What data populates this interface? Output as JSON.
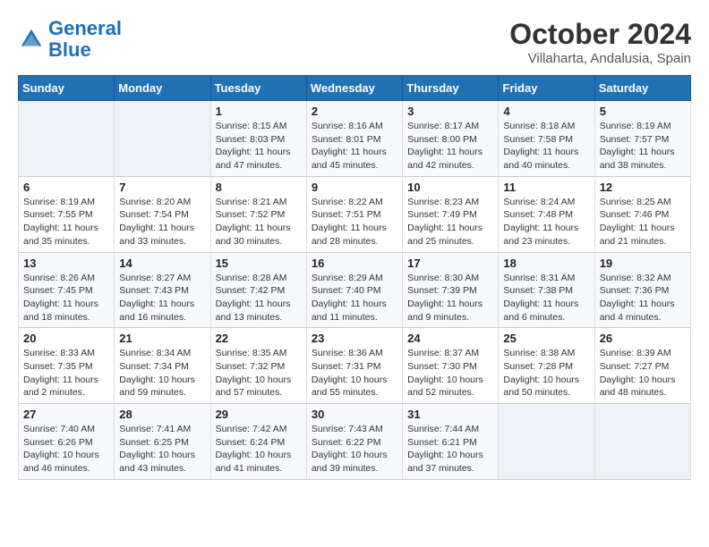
{
  "logo": {
    "line1": "General",
    "line2": "Blue"
  },
  "title": "October 2024",
  "location": "Villaharta, Andalusia, Spain",
  "days_of_week": [
    "Sunday",
    "Monday",
    "Tuesday",
    "Wednesday",
    "Thursday",
    "Friday",
    "Saturday"
  ],
  "weeks": [
    [
      {
        "day": "",
        "info": ""
      },
      {
        "day": "",
        "info": ""
      },
      {
        "day": "1",
        "info": "Sunrise: 8:15 AM\nSunset: 8:03 PM\nDaylight: 11 hours and 47 minutes."
      },
      {
        "day": "2",
        "info": "Sunrise: 8:16 AM\nSunset: 8:01 PM\nDaylight: 11 hours and 45 minutes."
      },
      {
        "day": "3",
        "info": "Sunrise: 8:17 AM\nSunset: 8:00 PM\nDaylight: 11 hours and 42 minutes."
      },
      {
        "day": "4",
        "info": "Sunrise: 8:18 AM\nSunset: 7:58 PM\nDaylight: 11 hours and 40 minutes."
      },
      {
        "day": "5",
        "info": "Sunrise: 8:19 AM\nSunset: 7:57 PM\nDaylight: 11 hours and 38 minutes."
      }
    ],
    [
      {
        "day": "6",
        "info": "Sunrise: 8:19 AM\nSunset: 7:55 PM\nDaylight: 11 hours and 35 minutes."
      },
      {
        "day": "7",
        "info": "Sunrise: 8:20 AM\nSunset: 7:54 PM\nDaylight: 11 hours and 33 minutes."
      },
      {
        "day": "8",
        "info": "Sunrise: 8:21 AM\nSunset: 7:52 PM\nDaylight: 11 hours and 30 minutes."
      },
      {
        "day": "9",
        "info": "Sunrise: 8:22 AM\nSunset: 7:51 PM\nDaylight: 11 hours and 28 minutes."
      },
      {
        "day": "10",
        "info": "Sunrise: 8:23 AM\nSunset: 7:49 PM\nDaylight: 11 hours and 25 minutes."
      },
      {
        "day": "11",
        "info": "Sunrise: 8:24 AM\nSunset: 7:48 PM\nDaylight: 11 hours and 23 minutes."
      },
      {
        "day": "12",
        "info": "Sunrise: 8:25 AM\nSunset: 7:46 PM\nDaylight: 11 hours and 21 minutes."
      }
    ],
    [
      {
        "day": "13",
        "info": "Sunrise: 8:26 AM\nSunset: 7:45 PM\nDaylight: 11 hours and 18 minutes."
      },
      {
        "day": "14",
        "info": "Sunrise: 8:27 AM\nSunset: 7:43 PM\nDaylight: 11 hours and 16 minutes."
      },
      {
        "day": "15",
        "info": "Sunrise: 8:28 AM\nSunset: 7:42 PM\nDaylight: 11 hours and 13 minutes."
      },
      {
        "day": "16",
        "info": "Sunrise: 8:29 AM\nSunset: 7:40 PM\nDaylight: 11 hours and 11 minutes."
      },
      {
        "day": "17",
        "info": "Sunrise: 8:30 AM\nSunset: 7:39 PM\nDaylight: 11 hours and 9 minutes."
      },
      {
        "day": "18",
        "info": "Sunrise: 8:31 AM\nSunset: 7:38 PM\nDaylight: 11 hours and 6 minutes."
      },
      {
        "day": "19",
        "info": "Sunrise: 8:32 AM\nSunset: 7:36 PM\nDaylight: 11 hours and 4 minutes."
      }
    ],
    [
      {
        "day": "20",
        "info": "Sunrise: 8:33 AM\nSunset: 7:35 PM\nDaylight: 11 hours and 2 minutes."
      },
      {
        "day": "21",
        "info": "Sunrise: 8:34 AM\nSunset: 7:34 PM\nDaylight: 10 hours and 59 minutes."
      },
      {
        "day": "22",
        "info": "Sunrise: 8:35 AM\nSunset: 7:32 PM\nDaylight: 10 hours and 57 minutes."
      },
      {
        "day": "23",
        "info": "Sunrise: 8:36 AM\nSunset: 7:31 PM\nDaylight: 10 hours and 55 minutes."
      },
      {
        "day": "24",
        "info": "Sunrise: 8:37 AM\nSunset: 7:30 PM\nDaylight: 10 hours and 52 minutes."
      },
      {
        "day": "25",
        "info": "Sunrise: 8:38 AM\nSunset: 7:28 PM\nDaylight: 10 hours and 50 minutes."
      },
      {
        "day": "26",
        "info": "Sunrise: 8:39 AM\nSunset: 7:27 PM\nDaylight: 10 hours and 48 minutes."
      }
    ],
    [
      {
        "day": "27",
        "info": "Sunrise: 7:40 AM\nSunset: 6:26 PM\nDaylight: 10 hours and 46 minutes."
      },
      {
        "day": "28",
        "info": "Sunrise: 7:41 AM\nSunset: 6:25 PM\nDaylight: 10 hours and 43 minutes."
      },
      {
        "day": "29",
        "info": "Sunrise: 7:42 AM\nSunset: 6:24 PM\nDaylight: 10 hours and 41 minutes."
      },
      {
        "day": "30",
        "info": "Sunrise: 7:43 AM\nSunset: 6:22 PM\nDaylight: 10 hours and 39 minutes."
      },
      {
        "day": "31",
        "info": "Sunrise: 7:44 AM\nSunset: 6:21 PM\nDaylight: 10 hours and 37 minutes."
      },
      {
        "day": "",
        "info": ""
      },
      {
        "day": "",
        "info": ""
      }
    ]
  ]
}
